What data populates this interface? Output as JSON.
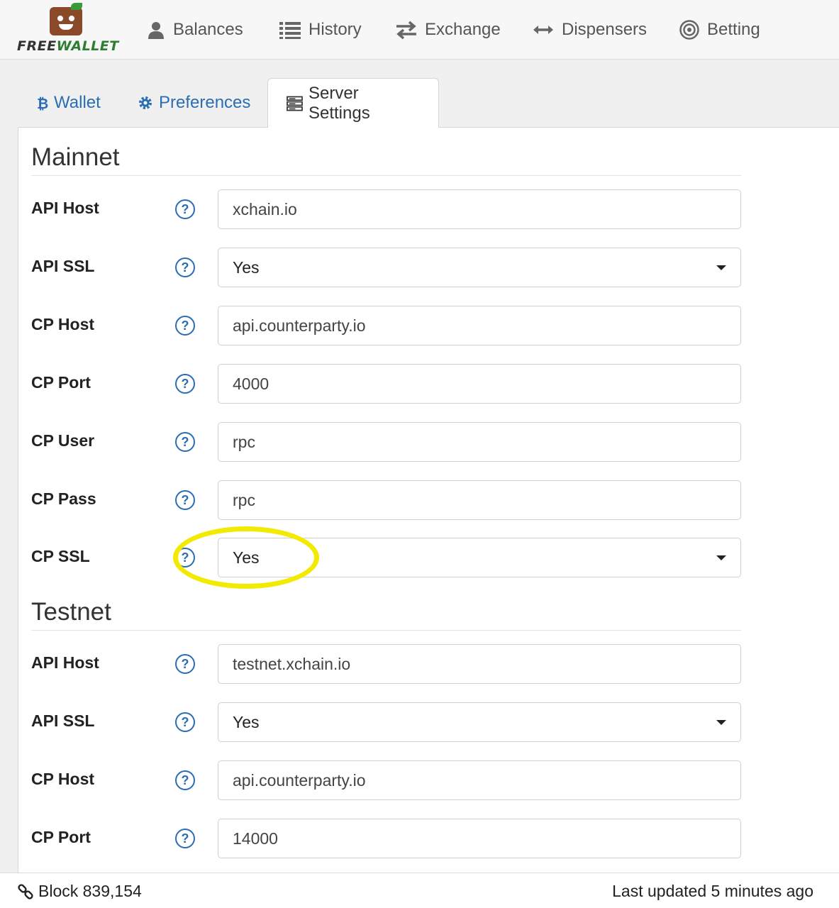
{
  "nav": {
    "logo_text_a": "FREE",
    "logo_text_b": "WALLET",
    "items": [
      {
        "label": "Balances",
        "icon": "user-icon"
      },
      {
        "label": "History",
        "icon": "list-icon"
      },
      {
        "label": "Exchange",
        "icon": "exchange-arrows-icon"
      },
      {
        "label": "Dispensers",
        "icon": "double-arrow-icon"
      },
      {
        "label": "Betting",
        "icon": "target-icon"
      }
    ]
  },
  "tabs": [
    {
      "label": "Wallet",
      "icon": "bitcoin-icon",
      "active": false
    },
    {
      "label": "Preferences",
      "icon": "gear-icon",
      "active": false
    },
    {
      "label": "Server Settings",
      "icon": "server-icon",
      "active": true
    }
  ],
  "help_symbol": "?",
  "mainnet": {
    "title": "Mainnet",
    "api_host": {
      "label": "API Host",
      "value": "xchain.io"
    },
    "api_ssl": {
      "label": "API SSL",
      "value": "Yes"
    },
    "cp_host": {
      "label": "CP Host",
      "value": "api.counterparty.io"
    },
    "cp_port": {
      "label": "CP Port",
      "value": "4000"
    },
    "cp_user": {
      "label": "CP User",
      "value": "rpc"
    },
    "cp_pass": {
      "label": "CP Pass",
      "value": "rpc"
    },
    "cp_ssl": {
      "label": "CP SSL",
      "value": "Yes"
    }
  },
  "testnet": {
    "title": "Testnet",
    "api_host": {
      "label": "API Host",
      "value": "testnet.xchain.io"
    },
    "api_ssl": {
      "label": "API SSL",
      "value": "Yes"
    },
    "cp_host": {
      "label": "CP Host",
      "value": "api.counterparty.io"
    },
    "cp_port": {
      "label": "CP Port",
      "value": "14000"
    }
  },
  "footer": {
    "block": "Block 839,154",
    "updated": "Last updated 5 minutes ago"
  },
  "colors": {
    "link_blue": "#2a6db5",
    "highlight_yellow": "#f2ea00",
    "logo_green": "#2e7d32"
  }
}
